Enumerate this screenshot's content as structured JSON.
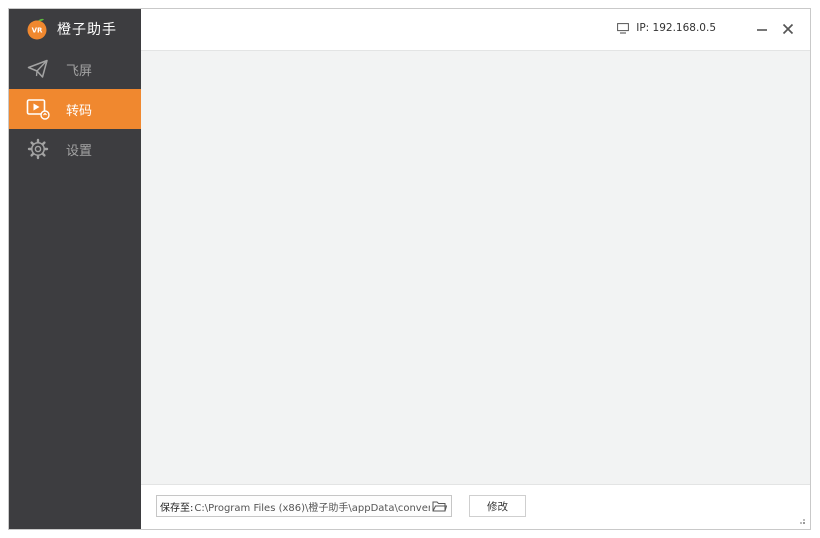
{
  "app": {
    "name": "橙子助手",
    "logo_text": "VR"
  },
  "colors": {
    "accent": "#f0882f",
    "sidebar_bg": "#3d3d40",
    "sidebar_text": "#a3a3a3"
  },
  "sidebar": {
    "items": [
      {
        "label": "飞屏",
        "icon": "paper-plane-icon",
        "active": false
      },
      {
        "label": "转码",
        "icon": "video-convert-icon",
        "active": true
      },
      {
        "label": "设置",
        "icon": "gear-icon",
        "active": false
      }
    ]
  },
  "titlebar": {
    "ip_text": "IP: 192.168.0.5",
    "ip_icon": "monitor-icon"
  },
  "footer": {
    "save_label": "保存至:",
    "save_path": "C:\\Program Files (x86)\\橙子助手\\appData\\conver...",
    "modify_label": "修改"
  }
}
